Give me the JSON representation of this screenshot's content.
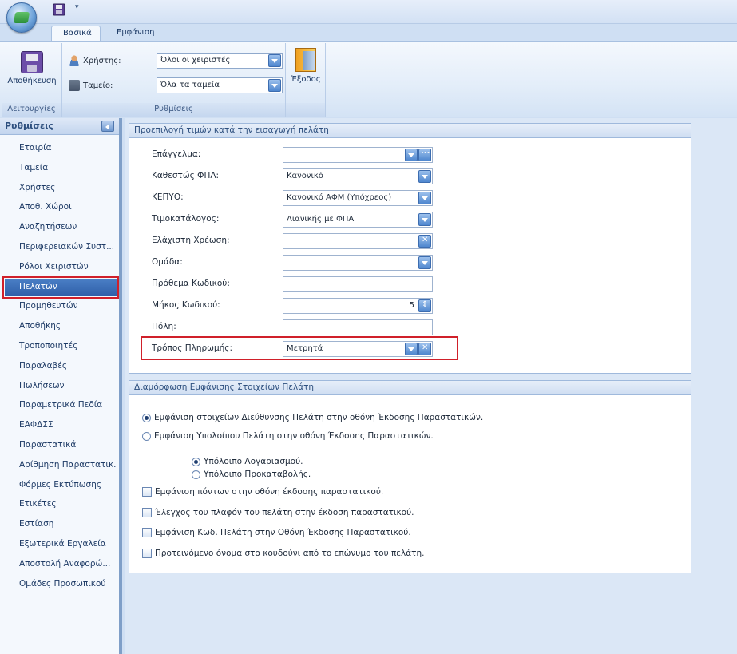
{
  "ribbon_tabs": [
    "Βασικά",
    "Εμφάνιση"
  ],
  "ribbon": {
    "save_label": "Αποθήκευση",
    "group_functions": "Λειτουργίες",
    "user_label": "Χρήστης:",
    "user_value": "Όλοι οι χειριστές",
    "till_label": "Ταμείο:",
    "till_value": "Όλα τα ταμεία",
    "group_settings": "Ρυθμίσεις",
    "exit_label": "Έξοδος"
  },
  "sidebar": {
    "title": "Ρυθμίσεις",
    "items": [
      "Εταιρία",
      "Ταμεία",
      "Χρήστες",
      "Αποθ. Χώροι",
      "Αναζητήσεων",
      "Περιφερειακών Συστ...",
      "Ρόλοι Χειριστών",
      "Πελατών",
      "Προμηθευτών",
      "Αποθήκης",
      "Τροποποιητές",
      "Παραλαβές",
      "Πωλήσεων",
      "Παραμετρικά Πεδία",
      "ΕΑΦΔΣΣ",
      "Παραστατικά",
      "Αρίθμηση Παραστατικ...",
      "Φόρμες Εκτύπωσης",
      "Ετικέτες",
      "Εστίαση",
      "Εξωτερικά Εργαλεία",
      "Αποστολή Αναφορώ...",
      "Ομάδες Προσωπικού"
    ],
    "active_index": 7
  },
  "defaults_panel": {
    "title": "Προεπιλογή τιμών κατά την εισαγωγή πελάτη",
    "fields": [
      {
        "label": "Επάγγελμα:",
        "value": ""
      },
      {
        "label": "Καθεστώς ΦΠΑ:",
        "value": "Κανονικό"
      },
      {
        "label": "ΚΕΠΥΟ:",
        "value": "Κανονικό ΑΦΜ (Υπόχρεος)"
      },
      {
        "label": "Τιμοκατάλογος:",
        "value": "Λιανικής με ΦΠΑ"
      },
      {
        "label": "Ελάχιστη Χρέωση:",
        "value": ""
      },
      {
        "label": "Ομάδα:",
        "value": ""
      },
      {
        "label": "Πρόθεμα Κωδικού:",
        "value": ""
      },
      {
        "label": "Μήκος Κωδικού:",
        "value": "5"
      },
      {
        "label": "Πόλη:",
        "value": ""
      },
      {
        "label": "Τρόπος Πληρωμής:",
        "value": "Μετρητά"
      }
    ]
  },
  "display_panel": {
    "title": "Διαμόρφωση Εμφάνισης Στοιχείων Πελάτη",
    "radio1": "Εμφάνιση στοιχείων Διεύθυνσης Πελάτη στην οθόνη Έκδοσης Παραστατικών.",
    "radio2": "Εμφάνιση Υπολοίπου Πελάτη στην οθόνη Έκδοσης Παραστατικών.",
    "sub_radio1": "Υπόλοιπο Λογαριασμού.",
    "sub_radio2": "Υπόλοιπο Προκαταβολής.",
    "check1": "Εμφάνιση πόντων στην οθόνη έκδοσης παραστατικού.",
    "check2": "Έλεγχος του πλαφόν του πελάτη στην έκδοση παραστατικού.",
    "check3": "Εμφάνιση Κωδ. Πελάτη στην Οθόνη Έκδοσης Παραστατικού.",
    "check4": "Προτεινόμενο όνομα στο κουδούνι από το επώνυμο του πελάτη."
  },
  "colors": {
    "accent": "#2f5fa8",
    "highlight": "#d0202a"
  }
}
